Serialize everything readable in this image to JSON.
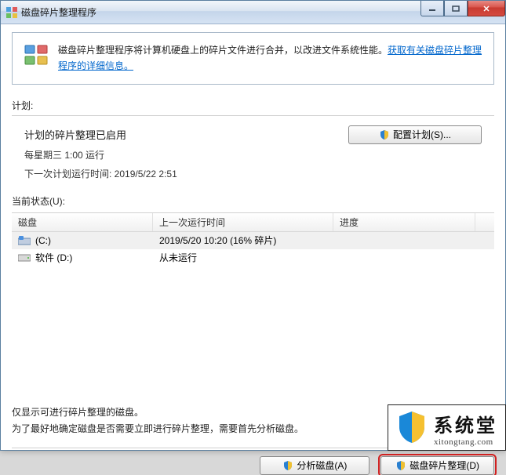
{
  "window": {
    "title": "磁盘碎片整理程序"
  },
  "banner": {
    "text": "磁盘碎片整理程序将计算机硬盘上的碎片文件进行合并，以改进文件系统性能。",
    "link": "获取有关磁盘碎片整理程序的详细信息。"
  },
  "labels": {
    "plan": "计划:",
    "status": "当前状态(U):"
  },
  "schedule": {
    "title": "计划的碎片整理已启用",
    "line1": "每星期三 1:00 运行",
    "line2": "下一次计划运行时间: 2019/5/22 2:51",
    "config_button": "配置计划(S)..."
  },
  "columns": {
    "disk": "磁盘",
    "last_run": "上一次运行时间",
    "progress": "进度"
  },
  "drives": [
    {
      "name": "(C:)",
      "last_run": "2019/5/20 10:20 (16% 碎片)",
      "type": "system"
    },
    {
      "name": "软件 (D:)",
      "last_run": "从未运行",
      "type": "data"
    }
  ],
  "footer": {
    "line1": "仅显示可进行碎片整理的磁盘。",
    "line2": "为了最好地确定磁盘是否需要立即进行碎片整理，需要首先分析磁盘。"
  },
  "buttons": {
    "analyze": "分析磁盘(A)",
    "defrag": "磁盘碎片整理(D)"
  },
  "watermark": {
    "main": "系统堂",
    "sub": "xitongtang.com"
  }
}
